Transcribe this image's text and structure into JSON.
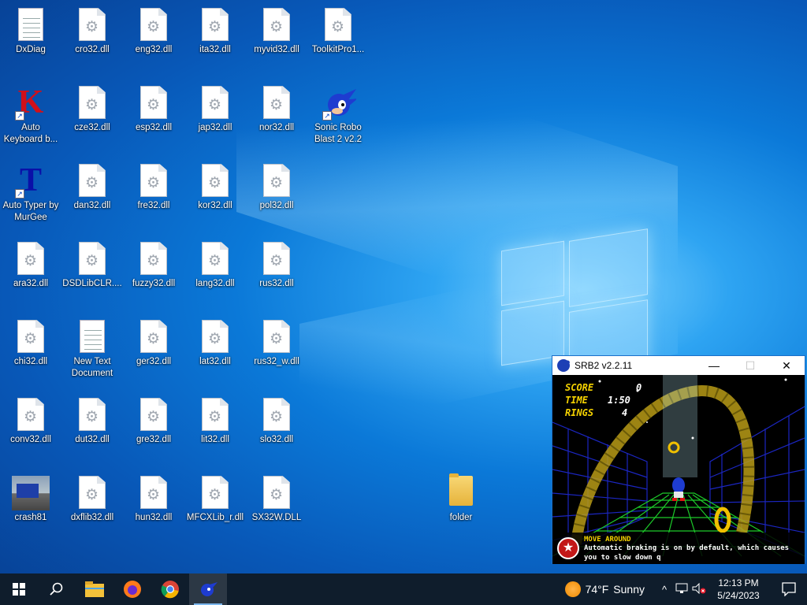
{
  "desktop": {
    "icons": [
      {
        "label": "DxDiag",
        "type": "txt"
      },
      {
        "label": "cro32.dll",
        "type": "dll"
      },
      {
        "label": "eng32.dll",
        "type": "dll"
      },
      {
        "label": "ita32.dll",
        "type": "dll"
      },
      {
        "label": "myvid32.dll",
        "type": "dll"
      },
      {
        "label": "ToolkitPro1...",
        "type": "dll"
      },
      {
        "label": "Auto Keyboard b...",
        "type": "K-shortcut"
      },
      {
        "label": "cze32.dll",
        "type": "dll"
      },
      {
        "label": "esp32.dll",
        "type": "dll"
      },
      {
        "label": "jap32.dll",
        "type": "dll"
      },
      {
        "label": "nor32.dll",
        "type": "dll"
      },
      {
        "label": "Sonic Robo Blast 2 v2.2",
        "type": "sonic-shortcut"
      },
      {
        "label": "Auto Typer by MurGee",
        "type": "T-shortcut"
      },
      {
        "label": "dan32.dll",
        "type": "dll"
      },
      {
        "label": "fre32.dll",
        "type": "dll"
      },
      {
        "label": "kor32.dll",
        "type": "dll"
      },
      {
        "label": "pol32.dll",
        "type": "dll"
      },
      {
        "label": "ara32.dll",
        "type": "dll"
      },
      {
        "label": "DSDLibCLR....",
        "type": "dll"
      },
      {
        "label": "fuzzy32.dll",
        "type": "dll"
      },
      {
        "label": "lang32.dll",
        "type": "dll"
      },
      {
        "label": "rus32.dll",
        "type": "dll"
      },
      {
        "label": "chi32.dll",
        "type": "dll"
      },
      {
        "label": "New Text Document",
        "type": "txt"
      },
      {
        "label": "ger32.dll",
        "type": "dll"
      },
      {
        "label": "lat32.dll",
        "type": "dll"
      },
      {
        "label": "rus32_w.dll",
        "type": "dll"
      },
      {
        "label": "conv32.dll",
        "type": "dll"
      },
      {
        "label": "dut32.dll",
        "type": "dll"
      },
      {
        "label": "gre32.dll",
        "type": "dll"
      },
      {
        "label": "lit32.dll",
        "type": "dll"
      },
      {
        "label": "slo32.dll",
        "type": "dll"
      },
      {
        "label": "crash81",
        "type": "image"
      },
      {
        "label": "dxflib32.dll",
        "type": "dll"
      },
      {
        "label": "hun32.dll",
        "type": "dll"
      },
      {
        "label": "MFCXLib_r.dll",
        "type": "dll"
      },
      {
        "label": "SX32W.DLL",
        "type": "dll"
      },
      {
        "label": "folder",
        "type": "folder"
      }
    ]
  },
  "window": {
    "title": "SRB2 v2.2.11",
    "minimize_glyph": "—",
    "maximize_glyph": "☐",
    "close_glyph": "✕",
    "hud": {
      "score_label": "SCORE",
      "score_value": "0",
      "time_label": "TIME",
      "time_value": "1:50",
      "rings_label": "RINGS",
      "rings_value": "4"
    },
    "tip_heading": "MOVE AROUND",
    "tip_text": "Automatic braking is on by default, which causes you to slow down q"
  },
  "taskbar": {
    "weather_temp": "74°F",
    "weather_desc": "Sunny",
    "time": "12:13 PM",
    "date": "5/24/2023",
    "items": [
      "start-icon",
      "search-icon",
      "file-explorer-icon",
      "firefox-icon",
      "chrome-icon",
      "srb2-icon"
    ],
    "accent": "#7cb7ee"
  }
}
